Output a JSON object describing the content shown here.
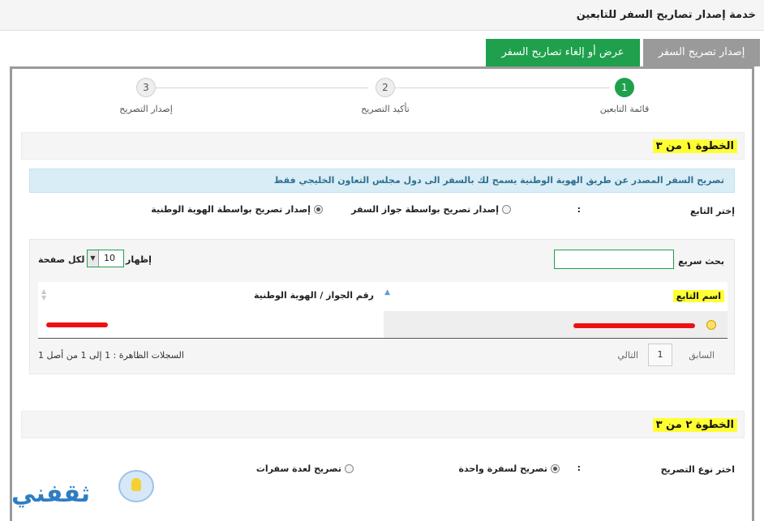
{
  "header": {
    "title": "خدمة إصدار تصاريح السفر للتابعين"
  },
  "tabs": [
    {
      "label": "إصدار تصريح السفر",
      "active": true
    },
    {
      "label": "عرض أو إلغاء تصاريح السفر",
      "active": false
    }
  ],
  "wizard": {
    "steps": [
      {
        "number": "1",
        "label": "قائمة التابعين",
        "current": true
      },
      {
        "number": "2",
        "label": "تأكيد التصريح",
        "current": false
      },
      {
        "number": "3",
        "label": "إصدار التصريح",
        "current": false
      }
    ]
  },
  "step1": {
    "title": "الخطوة ١ من ٣",
    "info": "تصريح السفر المصدر عن طريق الهوية الوطنية يسمح لك بالسفر الى دول مجلس التعاون الخليجي فقط",
    "choose_label": "إختر التابع",
    "colon": ":",
    "options": [
      {
        "label": "إصدار تصريح بواسطة جواز السفر",
        "selected": false
      },
      {
        "label": "إصدار تصريح بواسطة الهوية الوطنية",
        "selected": true
      }
    ],
    "table": {
      "search_label": "بحث سريع :",
      "show_label": "إظهار",
      "page_size": "10",
      "per_page_label": "لكل صفحة",
      "columns": [
        "اسم التابع",
        "رقم الجواز / الهوية الوطنية"
      ],
      "pager": {
        "prev": "السابق",
        "page": "1",
        "next": "التالي"
      },
      "records_info": "السجلات الظاهرة : 1 إلى 1 من أصل 1"
    }
  },
  "step2": {
    "title": "الخطوة ٢ من ٣",
    "choose_label": "اختر نوع التصريح",
    "colon": ":",
    "options": [
      {
        "label": "تصريح لسفرة واحدة",
        "selected": true
      },
      {
        "label": "تصريح لعدة سفرات",
        "selected": false
      }
    ]
  },
  "watermark": {
    "text": "ثقفني"
  },
  "colors": {
    "accent": "#1fa04c",
    "highlight": "#ffff33",
    "info_bg": "#d9edf7",
    "redaction": "#ee1111"
  }
}
